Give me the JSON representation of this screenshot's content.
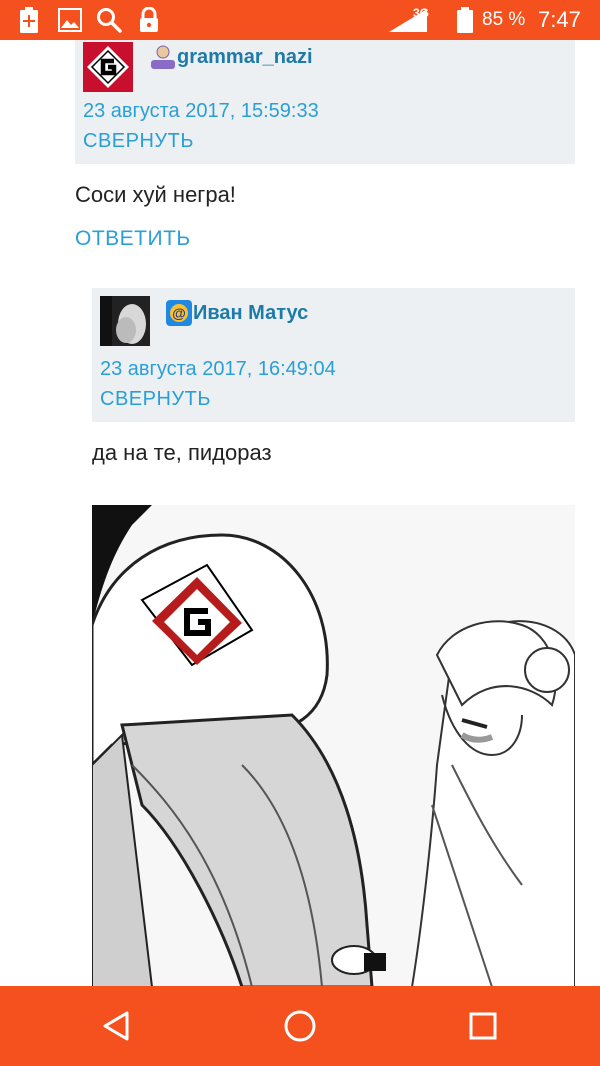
{
  "status_bar": {
    "network": "3G",
    "battery_percent": "85 %",
    "time": "7:47",
    "icons": [
      "battery-plus-icon",
      "image-icon",
      "search-icon",
      "lock-icon",
      "signal-icon",
      "battery-icon"
    ]
  },
  "comments": [
    {
      "username": "grammar_nazi",
      "date": "23 августа 2017, 15:59:33",
      "collapse_label": "СВЕРНУТЬ",
      "text": "Соси хуй негра!",
      "reply_label": "ОТВЕТИТЬ"
    },
    {
      "username": "Иван Матус",
      "date": "23 августа 2017, 16:49:04",
      "collapse_label": "СВЕРНУТЬ",
      "text": "да на те, пидораз"
    }
  ],
  "colors": {
    "accent": "#f4511e",
    "link": "#2a9fd6",
    "username": "#1e7aa8",
    "header_bg": "#ecf0f3"
  },
  "nav_bar": {
    "icons": [
      "back-icon",
      "home-icon",
      "recents-icon"
    ]
  }
}
